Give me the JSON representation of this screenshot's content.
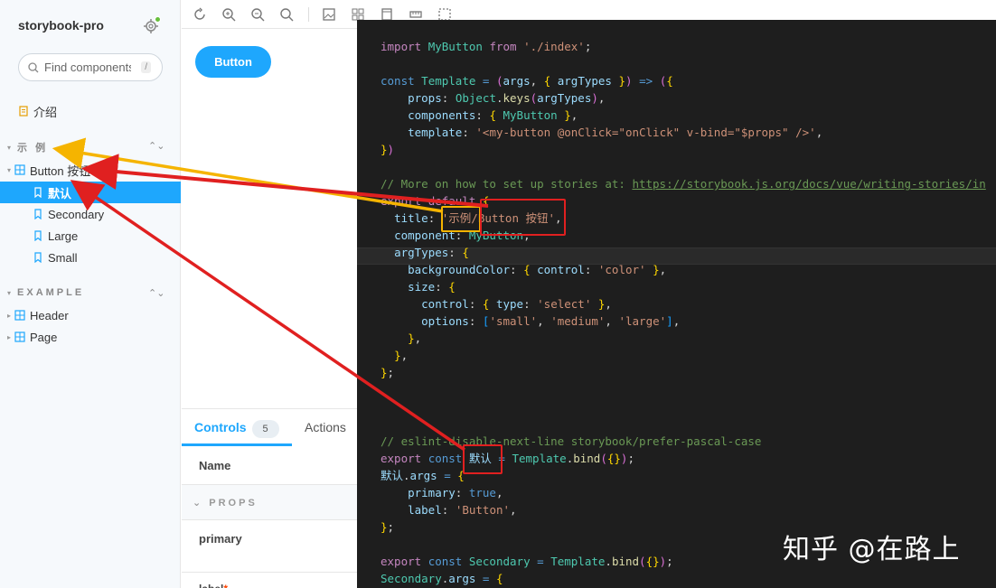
{
  "sidebar": {
    "brand": "storybook-pro",
    "search_placeholder": "Find components",
    "search_shortcut": "/",
    "intro_label": "介绍",
    "section_example_cn": "示 例",
    "group_button": "Button 按钮",
    "stories": [
      "默认",
      "Secondary",
      "Large",
      "Small"
    ],
    "section_example_en": "EXAMPLE",
    "en_items": [
      "Header",
      "Page"
    ]
  },
  "preview": {
    "button_label": "Button"
  },
  "addons": {
    "tab_controls": "Controls",
    "controls_count": "5",
    "tab_actions": "Actions",
    "col_name": "Name",
    "props_header": "PROPS",
    "row_primary": "primary",
    "row_label": "label"
  },
  "code": {
    "lines": [
      "import MyButton from './index';",
      "",
      "const Template = (args, { argTypes }) => ({",
      "    props: Object.keys(argTypes),",
      "    components: { MyButton },",
      "    template: '<my-button @onClick=\"onClick\" v-bind=\"$props\" />',",
      "})",
      "",
      "// More on how to set up stories at: https://storybook.js.org/docs/vue/writing-stories/in",
      "export default {",
      "  title: '示例/Button 按钮',",
      "  component: MyButton,",
      "  argTypes: {",
      "    backgroundColor: { control: 'color' },",
      "    size: {",
      "      control: { type: 'select' },",
      "      options: ['small', 'medium', 'large'],",
      "    },",
      "  },",
      "};",
      "",
      "",
      "",
      "// eslint-disable-next-line storybook/prefer-pascal-case",
      "export const 默认 = Template.bind({});",
      "默认.args = {",
      "    primary: true,",
      "    label: 'Button',",
      "};",
      "",
      "export const Secondary = Template.bind({});",
      "Secondary.args = {"
    ]
  },
  "watermark": "知乎 @在路上",
  "colors": {
    "accent": "#1ea7fd",
    "annotation_red": "#e02020",
    "annotation_yellow": "#f5b400",
    "code_bg": "#1e1e1e"
  }
}
